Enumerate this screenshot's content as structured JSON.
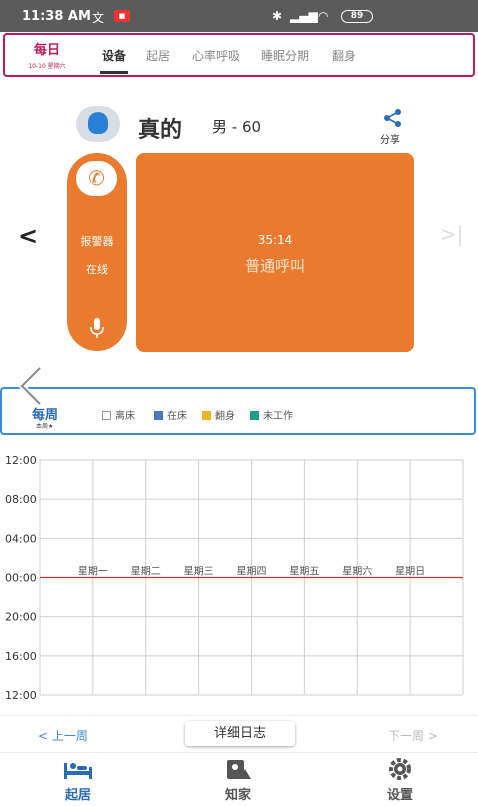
{
  "status_bar": {
    "time": "11:38 AM",
    "battery": "89"
  },
  "tabs": {
    "daily_label": "每日",
    "daily_date": "10-10 星期六",
    "items": [
      "设备",
      "起居",
      "心率呼吸",
      "睡眠分期",
      "翻身"
    ],
    "active": "设备"
  },
  "user": {
    "name": "真的",
    "info": "男 - 60",
    "share_label": "分享"
  },
  "alarm": {
    "device_label": "报警器",
    "status_label": "在线"
  },
  "card": {
    "time": "35:14",
    "status": "普通呼叫"
  },
  "weekly": {
    "title": "每周",
    "subtitle": "本周★",
    "legend": [
      {
        "label": "离床",
        "color": "#ffffff"
      },
      {
        "label": "在床",
        "color": "#4a78c2"
      },
      {
        "label": "翻身",
        "color": "#f0b429"
      },
      {
        "label": "未工作",
        "color": "#1e9e8a"
      }
    ]
  },
  "chart_data": {
    "type": "table",
    "y_tick_labels": [
      "12:00",
      "08:00",
      "04:00",
      "00:00",
      "20:00",
      "16:00",
      "12:00"
    ],
    "categories": [
      "星期一",
      "星期二",
      "星期三",
      "星期四",
      "星期五",
      "星期六",
      "星期日"
    ],
    "series": [],
    "grid": true,
    "reference_line_label": "00:00",
    "reference_line_color": "#c0392b"
  },
  "week_nav": {
    "prev": "< 上一周",
    "detail": "详细日志",
    "next": "下一周 >"
  },
  "bottom_nav": [
    {
      "label": "起居",
      "icon": "sleep-icon",
      "active": true
    },
    {
      "label": "知家",
      "icon": "home-icon",
      "active": false
    },
    {
      "label": "设置",
      "icon": "gear-icon",
      "active": false
    }
  ]
}
